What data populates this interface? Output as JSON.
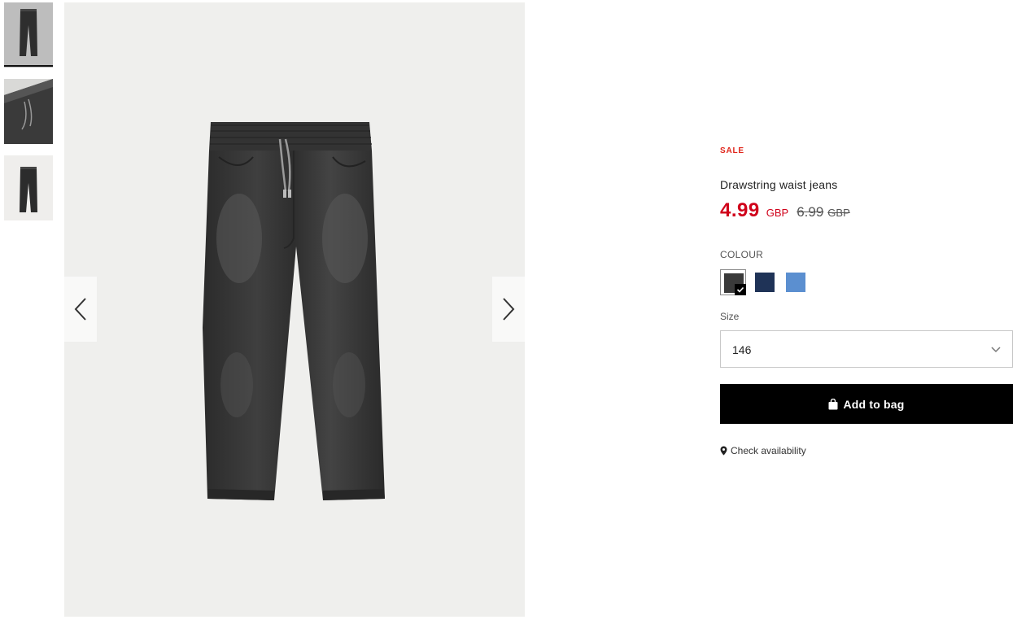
{
  "gallery": {
    "thumbnails": [
      {
        "name": "front-view"
      },
      {
        "name": "waist-detail"
      },
      {
        "name": "back-view"
      }
    ],
    "prev_icon": "chevron-left-icon",
    "next_icon": "chevron-right-icon"
  },
  "product": {
    "badge": "SALE",
    "title": "Drawstring waist jeans",
    "price": "4.99",
    "currency": "GBP",
    "old_price": "6.99",
    "old_currency": "GBP"
  },
  "colour": {
    "label": "COLOUR",
    "swatches": [
      {
        "color": "#3a3a3a",
        "selected": true
      },
      {
        "color": "#1f3357",
        "selected": false
      },
      {
        "color": "#5b8fd0",
        "selected": false
      }
    ]
  },
  "size": {
    "label": "Size",
    "selected": "146"
  },
  "actions": {
    "add_to_bag": "Add to bag",
    "check_availability": "Check availability"
  },
  "colors": {
    "sale": "#e0251a",
    "price": "#d0021b",
    "button": "#000000"
  }
}
